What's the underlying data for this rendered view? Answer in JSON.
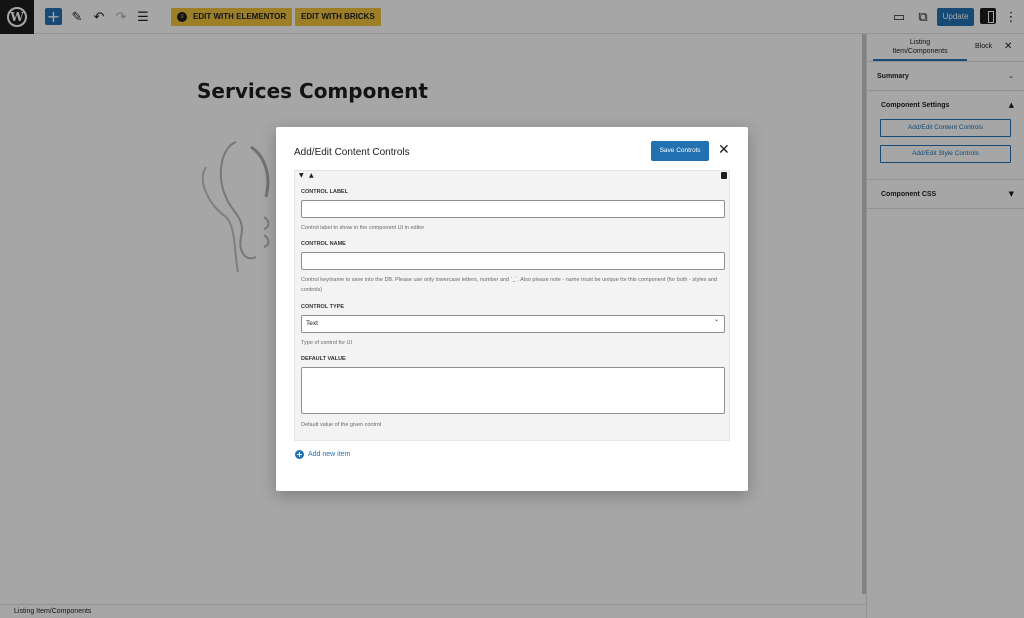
{
  "toolbar": {
    "elementor_label": "EDIT WITH ELEMENTOR",
    "bricks_label": "EDIT WITH BRICKS",
    "update_label": "Update"
  },
  "editor": {
    "post_title": "Services Component"
  },
  "sidebar": {
    "tab_listing_line1": "Listing",
    "tab_listing_line2": "Item/Components",
    "tab_block": "Block",
    "panels": {
      "summary": "Summary",
      "component_settings": "Component Settings",
      "content_controls_btn": "Add/Edit Content Controls",
      "style_controls_btn": "Add/Edit Style Controls",
      "component_css": "Component CSS"
    }
  },
  "modal": {
    "title": "Add/Edit Content Controls",
    "save_label": "Save Controls",
    "fields": {
      "control_label": "CONTROL LABEL",
      "control_label_help": "Control label to show in the component UI in editor",
      "control_name": "CONTROL NAME",
      "control_name_help": "Control key/name to save into the DB. Please use only lowercase letters, number and `_`. Also please note - name must be unique for this component (for both - styles and controls)",
      "control_type": "CONTROL TYPE",
      "control_type_value": "Text",
      "control_type_help": "Type of control for UI",
      "default_value": "DEFAULT VALUE",
      "default_value_help": "Default value of the given control"
    },
    "add_item_label": "Add new item"
  },
  "footer": {
    "breadcrumb": "Listing Item/Components"
  },
  "colors": {
    "accent": "#2271b1",
    "plugin_yellow": "#f0c33c",
    "dark": "#1e1e1e"
  }
}
